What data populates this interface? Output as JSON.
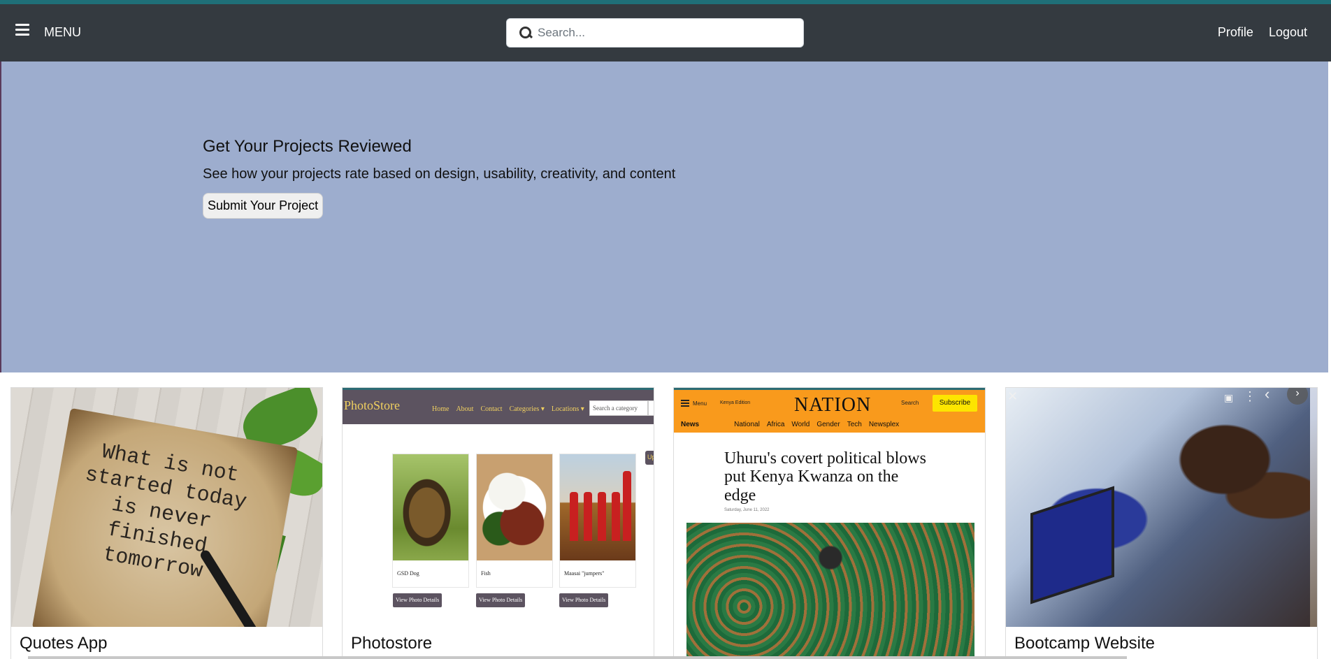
{
  "navbar": {
    "menu_label": "MENU",
    "search_placeholder": "Search...",
    "profile_label": "Profile",
    "logout_label": "Logout"
  },
  "hero": {
    "title": "Get Your Projects Reviewed",
    "subtitle": "See how your projects rate based on design, usability, creativity, and content",
    "button_label": "Submit Your Project"
  },
  "projects": [
    {
      "title": "Quotes App",
      "thumbnail": {
        "quote": "What is not\nstarted today\nis never\nfinished\ntomorrow"
      }
    },
    {
      "title": "Photostore",
      "thumbnail": {
        "brand": "PhotoStore",
        "nav_links": [
          "Home",
          "About",
          "Contact",
          "Categories ▾",
          "Locations ▾"
        ],
        "search_placeholder": "Search a category",
        "upload_label": "Up",
        "photos": [
          {
            "caption": "GSD Dog",
            "button": "View Photo Details"
          },
          {
            "caption": "Fish",
            "button": "View Photo Details"
          },
          {
            "caption": "Maasai \"jumpers\"",
            "button": "View Photo Details"
          }
        ]
      }
    },
    {
      "title": "",
      "thumbnail": {
        "menu_label": "Menu",
        "edition": "Kenya Edition",
        "logo": "NATION",
        "search_label": "Search",
        "subscribe_label": "Subscribe",
        "tabs": [
          "News",
          "National",
          "Africa",
          "World",
          "Gender",
          "Tech",
          "Newsplex"
        ],
        "headline": "Uhuru's covert political blows put Kenya Kwanza on the edge",
        "date": "Saturday, June 11, 2022"
      }
    },
    {
      "title": "Bootcamp Website",
      "thumbnail": {
        "close_glyph": "✕",
        "prev_glyph": "‹",
        "next_glyph": "›",
        "more_glyph": "⋮"
      }
    }
  ],
  "colors": {
    "navbar_bg": "#343a40",
    "hero_bg": "#9dadce",
    "top_accent": "#1f6f78"
  }
}
